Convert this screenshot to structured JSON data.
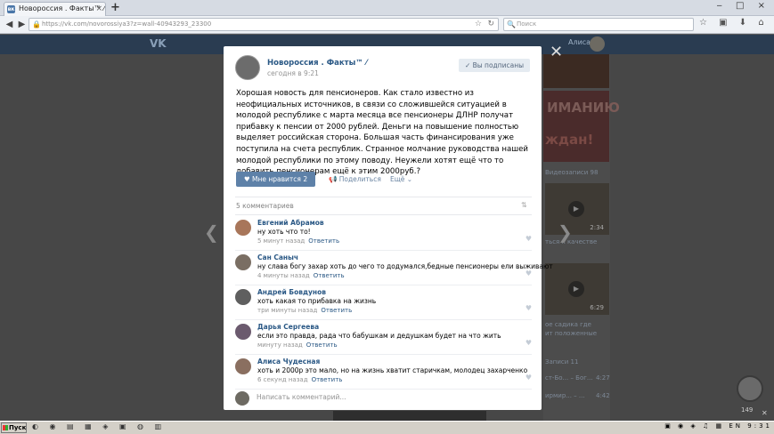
{
  "browser": {
    "tab_title": "Новороссия . Факты™ ⁄",
    "tab_close": "×",
    "new_tab": "+",
    "window_buttons": "‒ □ ×",
    "url": "https://vk.com/novorossiya3?z=wall-40943293_23300",
    "search_placeholder": "Поиск"
  },
  "vk": {
    "logo": "VK",
    "user_name": "Алиса",
    "right_images_text": [
      "ИМАНИЮ",
      "ждан!"
    ],
    "right_labels": {
      "videos_count": "Видеозаписи 98",
      "video1_duration": "2:34",
      "video1_caption": "ться к качестве",
      "video2_duration": "6:29",
      "video2_caption": "ое садика где",
      "video2_caption2": "ит положенные",
      "comments": "Записи 11",
      "r1": "ст-Бо... – Бог...",
      "r1t": "4:27",
      "r2": "ирмир... – ...",
      "r2t": "4:42"
    },
    "chat_count": "149"
  },
  "post": {
    "author": "Новороссия . Факты™ ⁄",
    "time": "сегодня в 9:21",
    "subscribed": "✓ Вы подписаны",
    "text": "Хорошая новость для пенсионеров. Как стало известно из неофициальных источников, в связи со сложившейся ситуацией в молодой республике с марта месяца все пенсионеры ДЛНР получат прибавку к пенсии от 2000 рублей. Деньги на повышение полностью выделяет российская сторона. Большая часть финансирования уже поступила на счета республик. Странное молчание руководства нашей молодой республики по этому поводу. Неужели хотят ещё что то добавить пенсионерам ещё к этим 2000руб.?",
    "like_label": "♥  Мне нравится  2",
    "share_label": "📢  Поделиться",
    "more_label": "Ещё ⌄",
    "comments_count": "5 комментариев",
    "sort_icon": "⇅",
    "input_placeholder": "Написать комментарий..."
  },
  "comments": [
    {
      "name": "Евгений Абрамов",
      "text": "ну хоть что то!",
      "time": "5 минут назад",
      "reply": "Ответить"
    },
    {
      "name": "Сан Саныч",
      "text": "ну слава богу захар хоть до чего то додумался,бедные пенсионеры ели выживают",
      "time": "4 минуты назад",
      "reply": "Ответить"
    },
    {
      "name": "Андрей Бовдунов",
      "text": "хоть какая то прибавка на жизнь",
      "time": "три минуты назад",
      "reply": "Ответить"
    },
    {
      "name": "Дарья Сергеева",
      "text": "если это правда, рада что бабушкам и дедушкам будет на что жить",
      "time": "минуту назад",
      "reply": "Ответить"
    },
    {
      "name": "Алиса Чудесная",
      "text": "хоть и 2000р это мало, но на жизнь хватит старичкам, молодец захарченко",
      "time": "6 секунд назад",
      "reply": "Ответить"
    }
  ],
  "taskbar": {
    "start": "Пуск",
    "lang": "EN",
    "clock": "9:31"
  }
}
